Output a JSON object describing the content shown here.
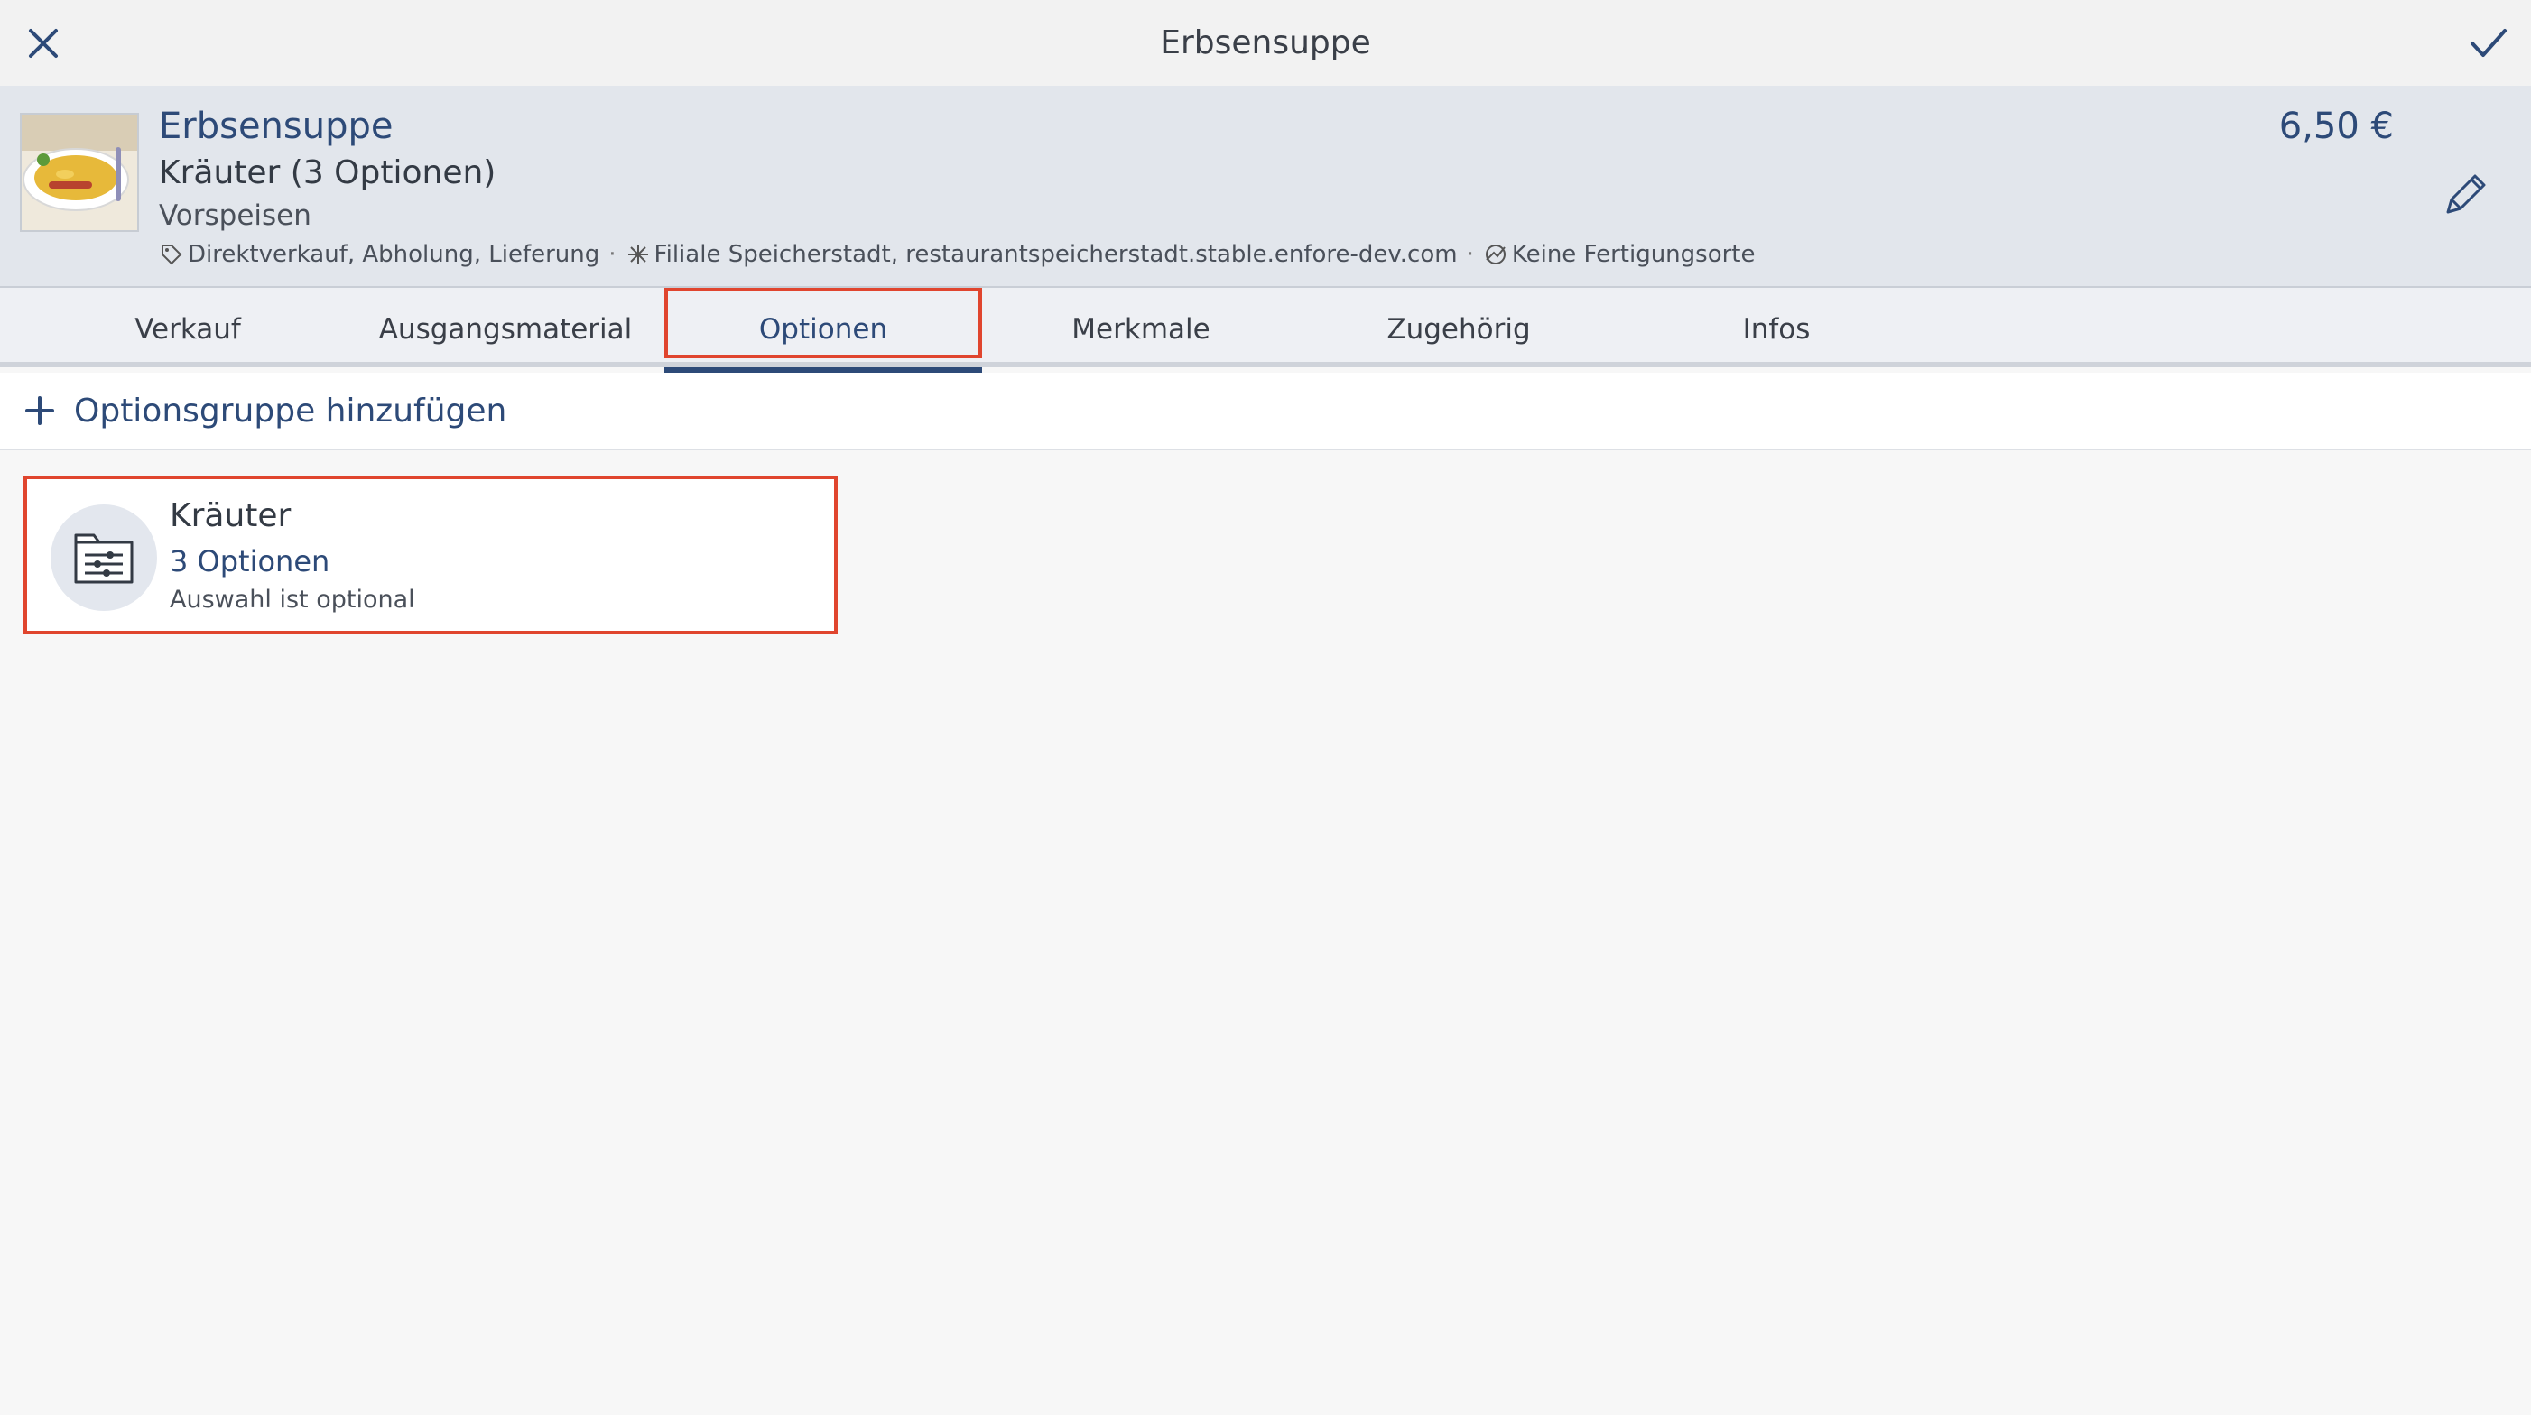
{
  "window": {
    "title": "Erbsensuppe",
    "close_icon": "close-icon",
    "confirm_icon": "check-icon"
  },
  "product": {
    "name": "Erbsensuppe",
    "options_summary": "Kräuter (3 Optionen)",
    "category": "Vorspeisen",
    "sales_channels": "Direktverkauf, Abholung, Lieferung",
    "branch": "Filiale Speicherstadt, restaurantspeicherstadt.stable.enfore-dev.com",
    "production": "Keine Fertigungsorte",
    "separator": "·",
    "price": "6,50 €",
    "edit_icon": "pencil-icon"
  },
  "tabs": [
    {
      "label": "Verkauf"
    },
    {
      "label": "Ausgangsmaterial"
    },
    {
      "label": "Optionen"
    },
    {
      "label": "Merkmale"
    },
    {
      "label": "Zugehörig"
    },
    {
      "label": "Infos"
    }
  ],
  "active_tab": "Optionen",
  "add_group": {
    "label": "Optionsgruppe hinzufügen",
    "icon": "plus-icon"
  },
  "option_groups": [
    {
      "name": "Kräuter",
      "count": "3 Optionen",
      "hint": "Auswahl ist optional",
      "icon": "options-folder-icon"
    }
  ],
  "colors": {
    "accent": "#2d4a78",
    "highlight": "#e0452e",
    "header_bg": "#e2e6ec"
  }
}
